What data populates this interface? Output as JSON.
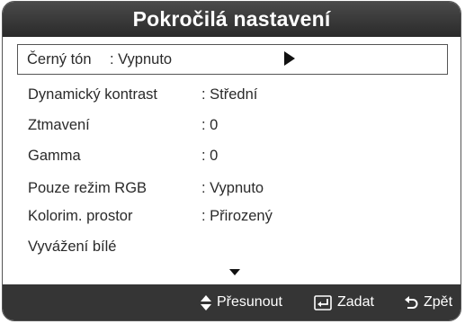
{
  "header": {
    "title": "Pokročilá nastavení"
  },
  "menu": {
    "items": [
      {
        "label": "Černý tón",
        "value": ": Vypnuto"
      },
      {
        "label": "Dynamický kontrast",
        "value": ": Střední"
      },
      {
        "label": "Ztmavení",
        "value": ": 0"
      },
      {
        "label": "Gamma",
        "value": ": 0"
      },
      {
        "label": "Pouze režim RGB",
        "value": ": Vypnuto"
      },
      {
        "label": "Kolorim. prostor",
        "value": ": Přirozený"
      },
      {
        "label": "Vyvážení bílé",
        "value": ""
      }
    ]
  },
  "footer": {
    "move_label": "Přesunout",
    "enter_label": "Zadat",
    "back_label": "Zpět"
  },
  "icons": {
    "selected_arrow": "right-triangle-icon",
    "scroll": "scroll-down-icon",
    "move": "up-down-arrows-icon",
    "enter": "enter-icon",
    "back": "return-icon"
  }
}
